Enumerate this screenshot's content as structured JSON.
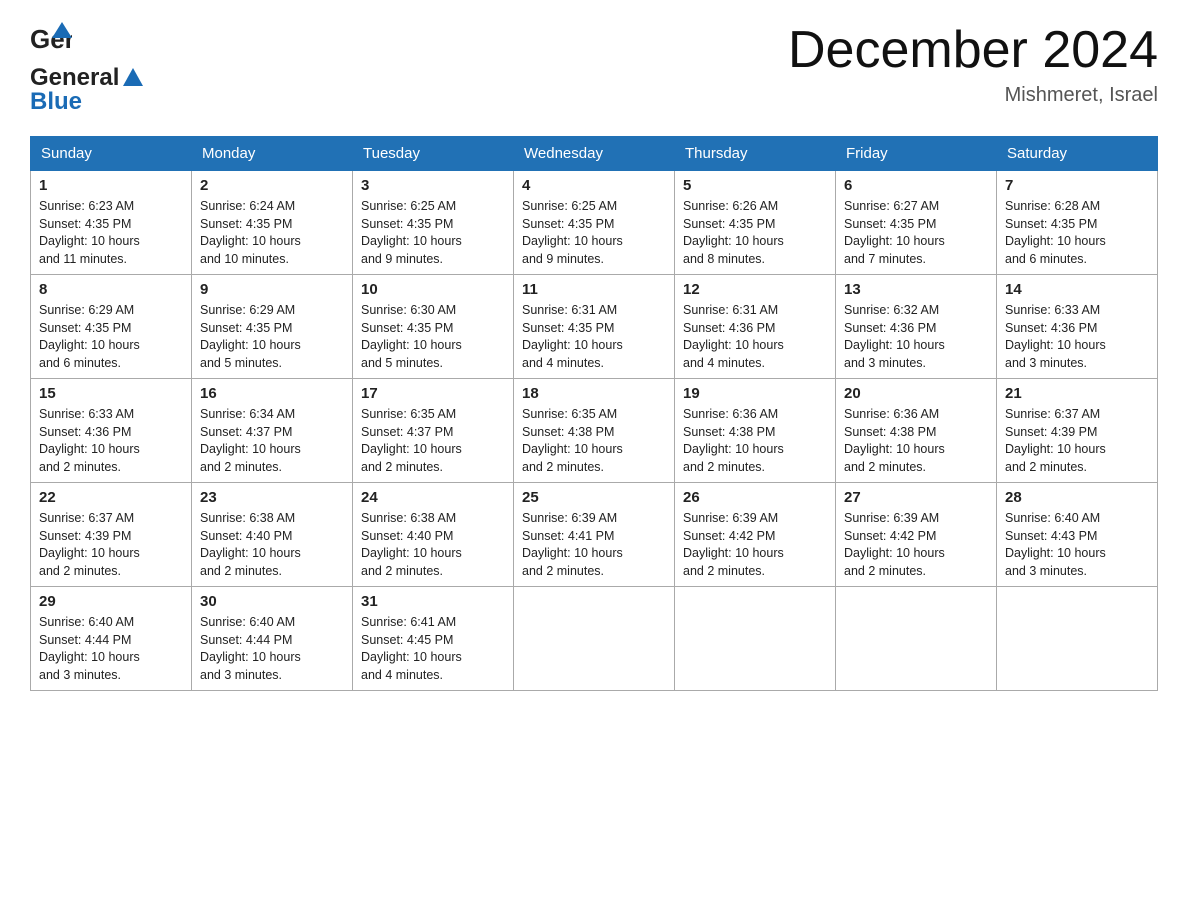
{
  "header": {
    "logo": {
      "general": "General",
      "blue": "Blue"
    },
    "title": "December 2024",
    "subtitle": "Mishmeret, Israel"
  },
  "weekdays": [
    "Sunday",
    "Monday",
    "Tuesday",
    "Wednesday",
    "Thursday",
    "Friday",
    "Saturday"
  ],
  "weeks": [
    {
      "days": [
        {
          "num": "1",
          "sunrise": "6:23 AM",
          "sunset": "4:35 PM",
          "daylight": "10 hours and 11 minutes."
        },
        {
          "num": "2",
          "sunrise": "6:24 AM",
          "sunset": "4:35 PM",
          "daylight": "10 hours and 10 minutes."
        },
        {
          "num": "3",
          "sunrise": "6:25 AM",
          "sunset": "4:35 PM",
          "daylight": "10 hours and 9 minutes."
        },
        {
          "num": "4",
          "sunrise": "6:25 AM",
          "sunset": "4:35 PM",
          "daylight": "10 hours and 9 minutes."
        },
        {
          "num": "5",
          "sunrise": "6:26 AM",
          "sunset": "4:35 PM",
          "daylight": "10 hours and 8 minutes."
        },
        {
          "num": "6",
          "sunrise": "6:27 AM",
          "sunset": "4:35 PM",
          "daylight": "10 hours and 7 minutes."
        },
        {
          "num": "7",
          "sunrise": "6:28 AM",
          "sunset": "4:35 PM",
          "daylight": "10 hours and 6 minutes."
        }
      ]
    },
    {
      "days": [
        {
          "num": "8",
          "sunrise": "6:29 AM",
          "sunset": "4:35 PM",
          "daylight": "10 hours and 6 minutes."
        },
        {
          "num": "9",
          "sunrise": "6:29 AM",
          "sunset": "4:35 PM",
          "daylight": "10 hours and 5 minutes."
        },
        {
          "num": "10",
          "sunrise": "6:30 AM",
          "sunset": "4:35 PM",
          "daylight": "10 hours and 5 minutes."
        },
        {
          "num": "11",
          "sunrise": "6:31 AM",
          "sunset": "4:35 PM",
          "daylight": "10 hours and 4 minutes."
        },
        {
          "num": "12",
          "sunrise": "6:31 AM",
          "sunset": "4:36 PM",
          "daylight": "10 hours and 4 minutes."
        },
        {
          "num": "13",
          "sunrise": "6:32 AM",
          "sunset": "4:36 PM",
          "daylight": "10 hours and 3 minutes."
        },
        {
          "num": "14",
          "sunrise": "6:33 AM",
          "sunset": "4:36 PM",
          "daylight": "10 hours and 3 minutes."
        }
      ]
    },
    {
      "days": [
        {
          "num": "15",
          "sunrise": "6:33 AM",
          "sunset": "4:36 PM",
          "daylight": "10 hours and 2 minutes."
        },
        {
          "num": "16",
          "sunrise": "6:34 AM",
          "sunset": "4:37 PM",
          "daylight": "10 hours and 2 minutes."
        },
        {
          "num": "17",
          "sunrise": "6:35 AM",
          "sunset": "4:37 PM",
          "daylight": "10 hours and 2 minutes."
        },
        {
          "num": "18",
          "sunrise": "6:35 AM",
          "sunset": "4:38 PM",
          "daylight": "10 hours and 2 minutes."
        },
        {
          "num": "19",
          "sunrise": "6:36 AM",
          "sunset": "4:38 PM",
          "daylight": "10 hours and 2 minutes."
        },
        {
          "num": "20",
          "sunrise": "6:36 AM",
          "sunset": "4:38 PM",
          "daylight": "10 hours and 2 minutes."
        },
        {
          "num": "21",
          "sunrise": "6:37 AM",
          "sunset": "4:39 PM",
          "daylight": "10 hours and 2 minutes."
        }
      ]
    },
    {
      "days": [
        {
          "num": "22",
          "sunrise": "6:37 AM",
          "sunset": "4:39 PM",
          "daylight": "10 hours and 2 minutes."
        },
        {
          "num": "23",
          "sunrise": "6:38 AM",
          "sunset": "4:40 PM",
          "daylight": "10 hours and 2 minutes."
        },
        {
          "num": "24",
          "sunrise": "6:38 AM",
          "sunset": "4:40 PM",
          "daylight": "10 hours and 2 minutes."
        },
        {
          "num": "25",
          "sunrise": "6:39 AM",
          "sunset": "4:41 PM",
          "daylight": "10 hours and 2 minutes."
        },
        {
          "num": "26",
          "sunrise": "6:39 AM",
          "sunset": "4:42 PM",
          "daylight": "10 hours and 2 minutes."
        },
        {
          "num": "27",
          "sunrise": "6:39 AM",
          "sunset": "4:42 PM",
          "daylight": "10 hours and 2 minutes."
        },
        {
          "num": "28",
          "sunrise": "6:40 AM",
          "sunset": "4:43 PM",
          "daylight": "10 hours and 3 minutes."
        }
      ]
    },
    {
      "days": [
        {
          "num": "29",
          "sunrise": "6:40 AM",
          "sunset": "4:44 PM",
          "daylight": "10 hours and 3 minutes."
        },
        {
          "num": "30",
          "sunrise": "6:40 AM",
          "sunset": "4:44 PM",
          "daylight": "10 hours and 3 minutes."
        },
        {
          "num": "31",
          "sunrise": "6:41 AM",
          "sunset": "4:45 PM",
          "daylight": "10 hours and 4 minutes."
        },
        null,
        null,
        null,
        null
      ]
    }
  ],
  "labels": {
    "sunrise": "Sunrise:",
    "sunset": "Sunset:",
    "daylight": "Daylight:"
  }
}
